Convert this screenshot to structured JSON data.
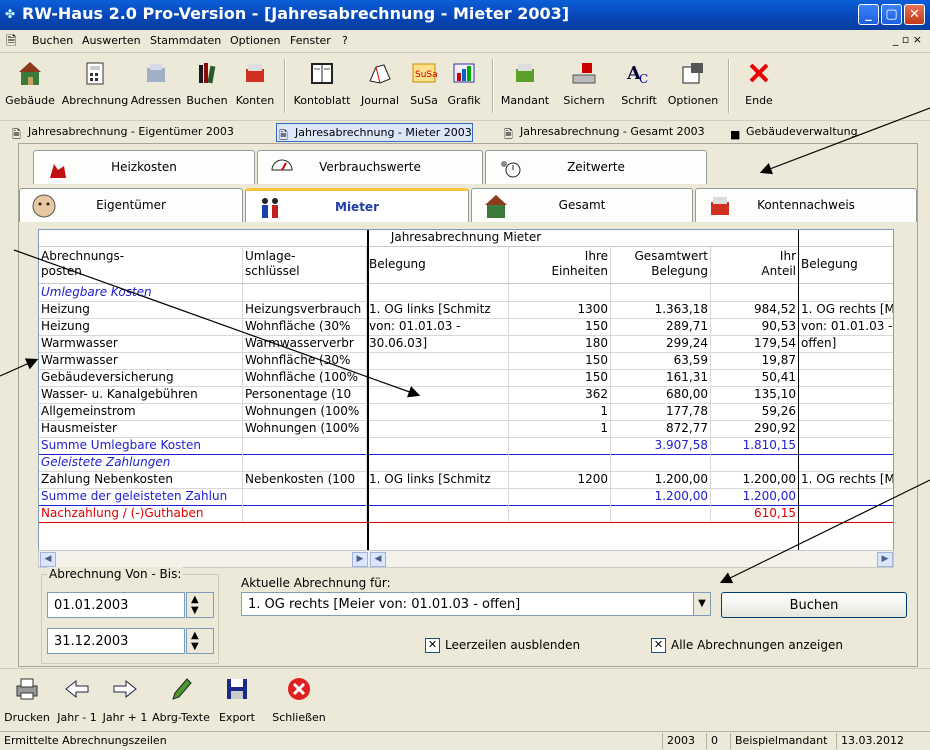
{
  "window": {
    "title": "RW-Haus 2.0 Pro-Version  - [Jahresabrechnung - Mieter 2003]"
  },
  "menu": [
    "Buchen",
    "Auswerten",
    "Stammdaten",
    "Optionen",
    "Fenster",
    "?"
  ],
  "mdi_controls": "_ ▫ ×",
  "toolbar": [
    {
      "label": "Gebäude",
      "icon": "building-icon"
    },
    {
      "label": "Abrechnung",
      "icon": "calculator-icon"
    },
    {
      "label": "Adressen",
      "icon": "address-card-icon"
    },
    {
      "label": "Buchen",
      "icon": "books-icon"
    },
    {
      "label": "Konten",
      "icon": "account-box-icon"
    },
    {
      "label": "Kontoblatt",
      "icon": "ledger-icon"
    },
    {
      "label": "Journal",
      "icon": "journal-icon"
    },
    {
      "label": "SuSa",
      "icon": "susa-icon"
    },
    {
      "label": "Grafik",
      "icon": "chart-icon"
    },
    {
      "label": "Mandant",
      "icon": "client-box-icon"
    },
    {
      "label": "Sichern",
      "icon": "save-drive-icon"
    },
    {
      "label": "Schrift",
      "icon": "font-icon"
    },
    {
      "label": "Optionen",
      "icon": "options-icon"
    },
    {
      "label": "Ende",
      "icon": "exit-x-icon"
    }
  ],
  "window_tabs": [
    {
      "label": "Jahresabrechnung - Eigentümer 2003",
      "active": false
    },
    {
      "label": "Jahresabrechnung - Mieter 2003",
      "active": true
    },
    {
      "label": "Jahresabrechnung - Gesamt 2003",
      "active": false
    },
    {
      "label": "Gebäudeverwaltung",
      "active": false
    }
  ],
  "tabs_row1": [
    "Heizkosten",
    "Verbrauchswerte",
    "Zeitwerte"
  ],
  "tabs_row2": [
    "Eigentümer",
    "Mieter",
    "Gesamt",
    "Kontennachweis"
  ],
  "grid": {
    "title": "Jahresabrechnung Mieter",
    "headers": [
      "Abrechnungs-\nposten",
      "Umlage-\nschlüssel",
      "Belegung",
      "Ihre\nEinheiten",
      "Gesamtwert\nBelegung",
      "Ihr\nAnteil",
      "Belegung"
    ],
    "rows": [
      {
        "c": [
          "Umlegbare Kosten",
          "",
          "",
          "",
          "",
          "",
          ""
        ],
        "style": "section"
      },
      {
        "c": [
          "Heizung",
          "Heizungsverbrauch",
          "1. OG links [Schmitz",
          "1300",
          "1.363,18",
          "984,52",
          "1. OG rechts [M"
        ]
      },
      {
        "c": [
          "Heizung",
          "Wohnfläche (30%",
          "von: 01.01.03 -",
          "150",
          "289,71",
          "90,53",
          "von: 01.01.03 -"
        ]
      },
      {
        "c": [
          "Warmwasser",
          "Warmwasserverbr",
          "30.06.03]",
          "180",
          "299,24",
          "179,54",
          "offen]"
        ]
      },
      {
        "c": [
          "Warmwasser",
          "Wohnfläche (30%",
          "",
          "150",
          "63,59",
          "19,87",
          ""
        ]
      },
      {
        "c": [
          "Gebäudeversicherung",
          "Wohnfläche (100%",
          "",
          "150",
          "161,31",
          "50,41",
          ""
        ]
      },
      {
        "c": [
          "Wasser- u. Kanalgebühren",
          "Personentage (10",
          "",
          "362",
          "680,00",
          "135,10",
          ""
        ]
      },
      {
        "c": [
          "Allgemeinstrom",
          "Wohnungen (100%",
          "",
          "1",
          "177,78",
          "59,26",
          ""
        ]
      },
      {
        "c": [
          "Hausmeister",
          "Wohnungen (100%",
          "",
          "1",
          "872,77",
          "290,92",
          ""
        ]
      },
      {
        "c": [
          "Summe Umlegbare Kosten",
          "",
          "",
          "",
          "3.907,58",
          "1.810,15",
          ""
        ],
        "style": "sum"
      },
      {
        "c": [
          "Geleistete Zahlungen",
          "",
          "",
          "",
          "",
          "",
          ""
        ],
        "style": "section"
      },
      {
        "c": [
          "Zahlung Nebenkosten",
          "Nebenkosten (100",
          "1. OG links [Schmitz",
          "1200",
          "1.200,00",
          "1.200,00",
          "1. OG rechts [M"
        ]
      },
      {
        "c": [
          "Summe der geleisteten Zahlun",
          "",
          "",
          "",
          "1.200,00",
          "1.200,00",
          ""
        ],
        "style": "sum"
      },
      {
        "c": [
          "Nachzahlung / (-)Guthaben",
          "",
          "",
          "",
          "",
          "610,15",
          ""
        ],
        "style": "red"
      }
    ]
  },
  "period": {
    "legend": "Abrechnung Von - Bis:",
    "from": "01.01.2003",
    "to": "31.12.2003"
  },
  "current": {
    "label": "Aktuelle Abrechnung für:",
    "value": "1. OG rechts [Meier von: 01.01.03 - offen]"
  },
  "buchen_button": "Buchen",
  "checkbox_leer": "Leerzeilen ausblenden",
  "checkbox_alle": "Alle Abrechnungen anzeigen",
  "bottom_toolbar": [
    "Drucken",
    "Jahr - 1",
    "Jahr + 1",
    "Abrg-Texte",
    "Export",
    "Schließen"
  ],
  "status": {
    "text": "Ermittelte Abrechnungszeilen",
    "year": "2003",
    "count": "0",
    "client": "Beispielmandant",
    "date": "13.03.2012"
  },
  "colors": {
    "title_blue": "#0845b5",
    "sum_blue": "#2020d0",
    "red": "#e00000",
    "active_tab": "#ffc83c"
  }
}
